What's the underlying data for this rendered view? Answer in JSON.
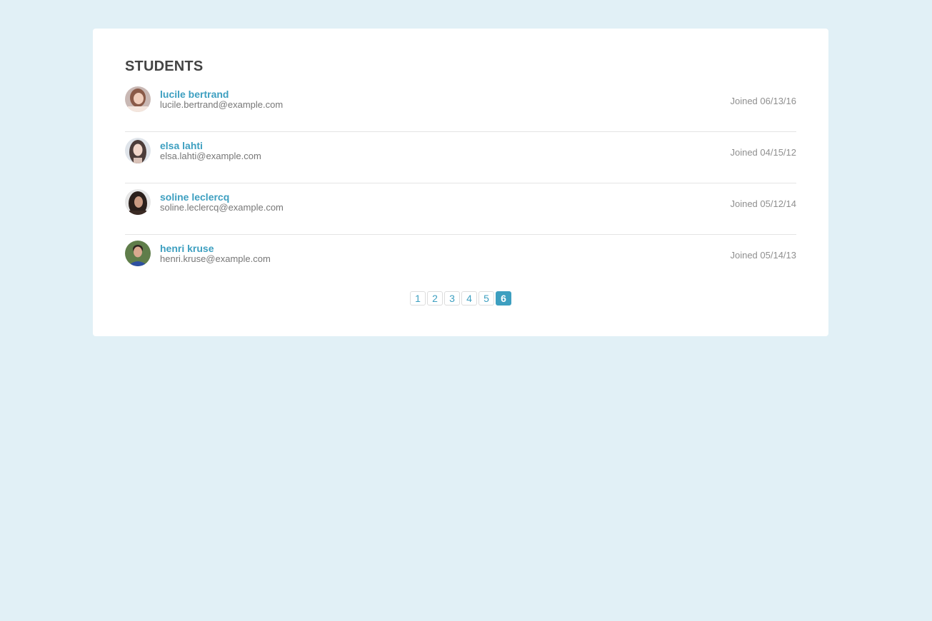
{
  "panel": {
    "title": "STUDENTS"
  },
  "students": [
    {
      "name": "lucile bertrand",
      "email": "lucile.bertrand@example.com",
      "joined": "Joined 06/13/16"
    },
    {
      "name": "elsa lahti",
      "email": "elsa.lahti@example.com",
      "joined": "Joined 04/15/12"
    },
    {
      "name": "soline leclercq",
      "email": "soline.leclercq@example.com",
      "joined": "Joined 05/12/14"
    },
    {
      "name": "henri kruse",
      "email": "henri.kruse@example.com",
      "joined": "Joined 05/14/13"
    }
  ],
  "pagination": {
    "pages": [
      "1",
      "2",
      "3",
      "4",
      "5",
      "6"
    ],
    "current": "6"
  },
  "colors": {
    "background": "#e1f0f6",
    "accent": "#3d9fc0",
    "card": "#ffffff",
    "title": "#444444"
  }
}
